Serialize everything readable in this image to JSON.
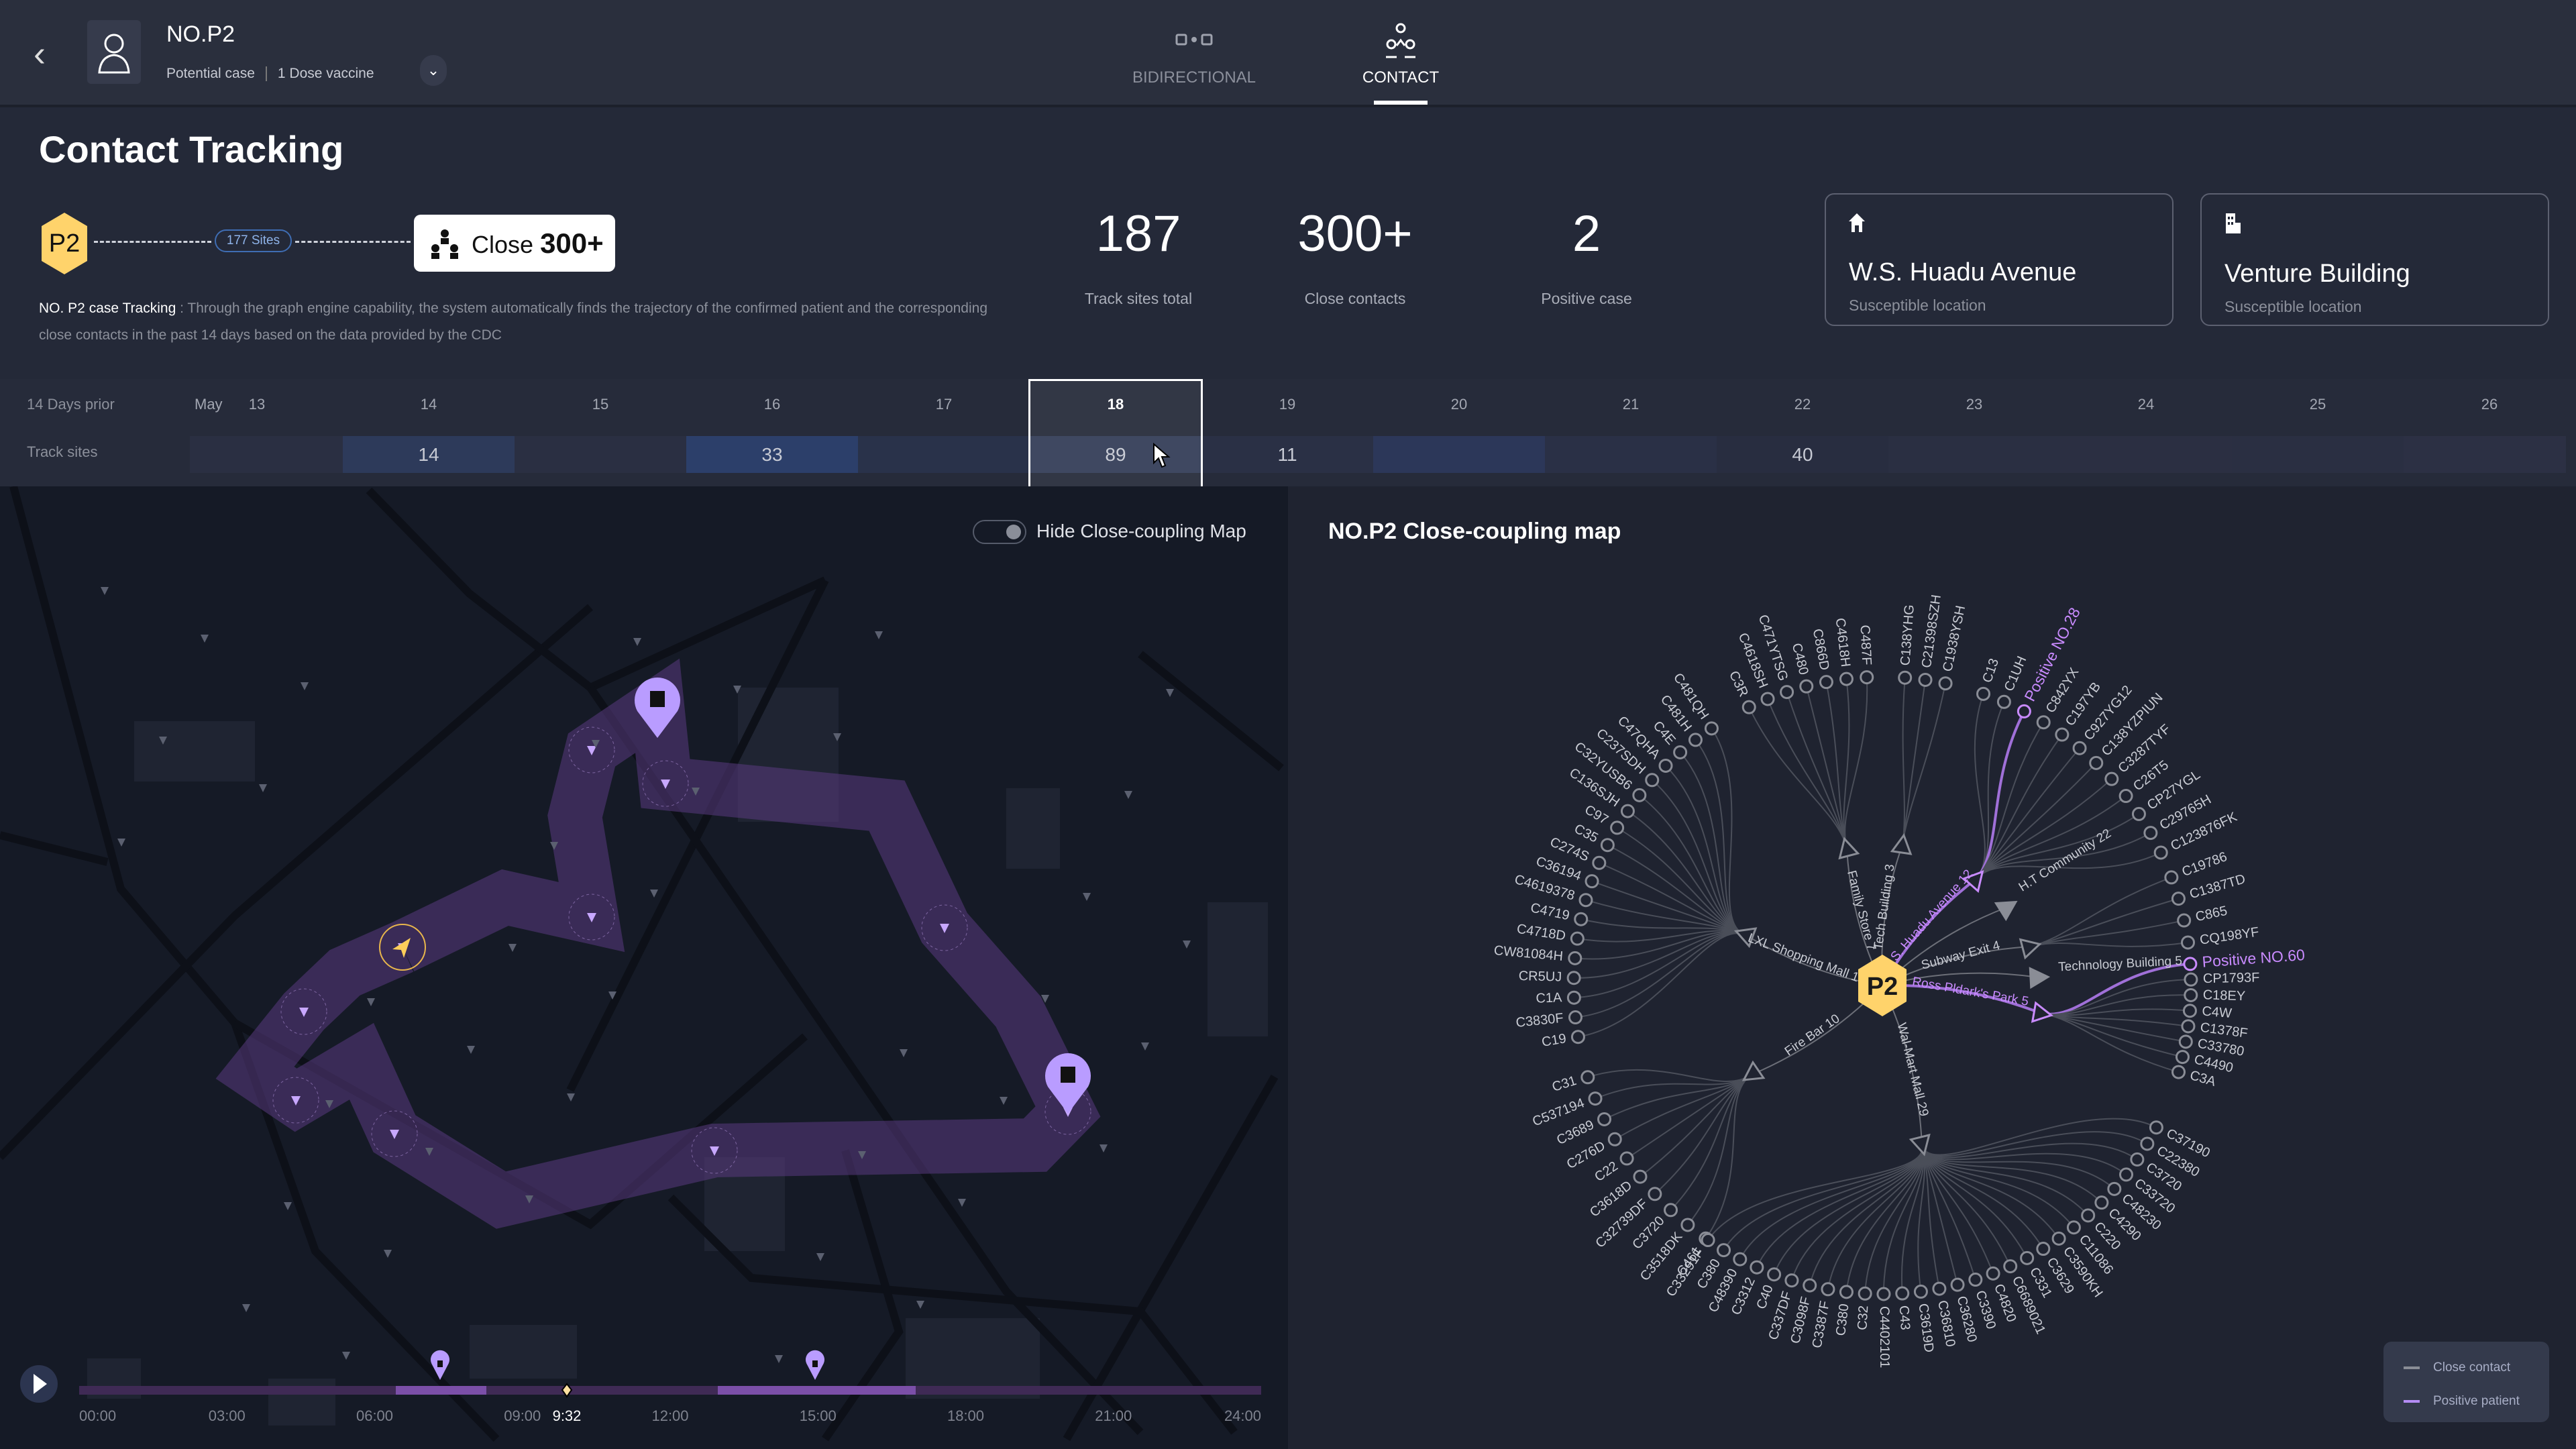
{
  "header": {
    "back_icon": "chevron-left-icon",
    "patient_id": "NO.P2",
    "status": "Potential case",
    "vaccine": "1 Dose vaccine",
    "expand_icon": "chevron-down-icon"
  },
  "tabs": [
    {
      "label": "BIDIRECTIONAL",
      "icon": "bidirectional-icon",
      "active": false
    },
    {
      "label": "CONTACT",
      "icon": "contact-icon",
      "active": true
    }
  ],
  "summary": {
    "title": "Contact Tracking",
    "case_badge": "P2",
    "sites_pill": "177 Sites",
    "close_label": "Close",
    "close_count": "300+",
    "desc_lead": "NO. P2 case Tracking",
    "desc_text": " : Through the graph engine capability, the system automatically finds the trajectory of the confirmed patient and the corresponding close contacts in the past 14 days based on the data provided by the CDC"
  },
  "stats": [
    {
      "value": "187",
      "label": "Track sites total"
    },
    {
      "value": "300+",
      "label": "Close contacts"
    },
    {
      "value": "2",
      "label": "Positive case"
    }
  ],
  "cards": [
    {
      "icon": "home-icon",
      "name": "W.S. Huadu Avenue",
      "sub": "Susceptible location"
    },
    {
      "icon": "building-icon",
      "name": "Venture Building",
      "sub": "Susceptible location"
    }
  ],
  "timeline": {
    "row1_label": "14 Days prior",
    "month": "May",
    "row2_label": "Track sites",
    "days": [
      "13",
      "14",
      "15",
      "16",
      "17",
      "18",
      "19",
      "20",
      "21",
      "22",
      "23",
      "24",
      "25",
      "26"
    ],
    "values": [
      "",
      "14",
      "",
      "33",
      "",
      "89",
      "11",
      "",
      "",
      "40",
      "",
      "",
      "",
      ""
    ],
    "selected_day": "18"
  },
  "map": {
    "toggle_label": "Hide Close-coupling Map",
    "toggle_on": false,
    "current_time": "9:32",
    "hours": [
      "00:00",
      "03:00",
      "06:00",
      "09:00",
      "12:00",
      "15:00",
      "18:00",
      "21:00",
      "24:00"
    ]
  },
  "graph": {
    "title": "NO.P2  Close-coupling map",
    "center": "P2",
    "colors": {
      "contact": "#8a8d96",
      "positive": "#c98bff",
      "center": "#ffd36b"
    },
    "hubs": [
      {
        "name": "LXL Shopping Mall 19",
        "positive": false,
        "leaves": [
          "C481QH",
          "C481H",
          "C4E",
          "C47QHA",
          "C237SDH",
          "C32YUSB6",
          "C136SJH",
          "C97",
          "C35",
          "C274S",
          "C36194",
          "C4619378",
          "C4719",
          "C4718D",
          "CW81084H",
          "CR5UJ",
          "C1A",
          "C3830F",
          "C19"
        ]
      },
      {
        "name": "Family Store 7",
        "positive": false,
        "leaves": [
          "C3R",
          "C4618SH",
          "C471YTSG",
          "C480",
          "C866D",
          "C4618H",
          "C487F"
        ]
      },
      {
        "name": "Tech Building 3",
        "positive": false,
        "leaves": [
          "C138YHG",
          "C21398SZH",
          "C1938YSH"
        ]
      },
      {
        "name": "W.S. Huadu Avenue 12",
        "positive": true,
        "leaves": [
          "C13",
          "C1UH",
          "Positive  NO.28",
          "C842YX",
          "C197YB",
          "C927YG12",
          "C138YZPIUN",
          "C3287TYF",
          "C26T5",
          "CP27YGL",
          "C29765H",
          "C123876FK"
        ],
        "positive_leaf": "Positive  NO.28"
      },
      {
        "name": "H.T Community 22",
        "positive": false,
        "leaves": []
      },
      {
        "name": "Subway Exit 4",
        "positive": false,
        "leaves": [
          "C19786",
          "C1387TD",
          "C865",
          "CQ198YF"
        ]
      },
      {
        "name": "Technology Building 5",
        "positive": false,
        "leaves": []
      },
      {
        "name": "Ross Pldark's Park 5",
        "positive": true,
        "leaves": [
          "Positive  NO.60",
          "CP1793F",
          "C18EY",
          "C4W",
          "C1378F",
          "C33780",
          "C4490",
          "C3A"
        ],
        "positive_leaf": "Positive  NO.60"
      },
      {
        "name": "Fire Bar 10",
        "positive": false,
        "leaves": [
          "C31",
          "C537194",
          "C3689",
          "C276D",
          "C22",
          "C3618D",
          "C32739DF",
          "C3720",
          "C3518DK",
          "C461"
        ]
      },
      {
        "name": "Wal-Mart Mall 29",
        "positive": false,
        "leaves": [
          "C37190",
          "C22380",
          "C3720",
          "C33720",
          "C48230",
          "C4290",
          "C220",
          "C11086",
          "C3590KH",
          "C3629",
          "C331",
          "C6689021",
          "C4820",
          "C3390",
          "C36280",
          "C36810",
          "C3619D",
          "C43",
          "C4402101",
          "C32",
          "C380",
          "C3387F",
          "C3098F",
          "C337DF",
          "C40",
          "C3312",
          "C48390",
          "C380",
          "C33291F"
        ]
      }
    ]
  },
  "legend": [
    {
      "label": "Close contact",
      "color": "#8a8d96"
    },
    {
      "label": "Positive patient",
      "color": "#b58cf5"
    }
  ]
}
